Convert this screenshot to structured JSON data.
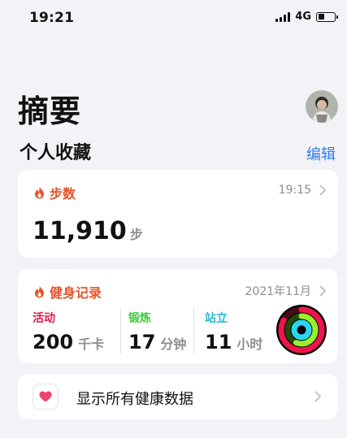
{
  "status_bar": {
    "time": "19:21",
    "network": "4G"
  },
  "page_title": "摘要",
  "favorites": {
    "title": "个人收藏",
    "edit_label": "编辑"
  },
  "steps_card": {
    "title": "步数",
    "time": "19:15",
    "value": "11,910",
    "unit": "步",
    "accent_color": "#e8532b"
  },
  "fitness_card": {
    "title": "健身记录",
    "date": "2021年11月",
    "metrics": [
      {
        "label": "活动",
        "value": "200",
        "unit": "千卡",
        "color": "#e8184a"
      },
      {
        "label": "锻炼",
        "value": "17",
        "unit": "分钟",
        "color": "#3dcc3a"
      },
      {
        "label": "站立",
        "value": "11",
        "unit": "小时",
        "color": "#29b9d6"
      }
    ]
  },
  "health_data": {
    "label": "显示所有健康数据",
    "icon": "heart-icon"
  },
  "icons": [
    "flame-icon",
    "chevron-right-icon",
    "heart-icon",
    "signal-icon",
    "battery-icon",
    "activity-rings-icon"
  ]
}
